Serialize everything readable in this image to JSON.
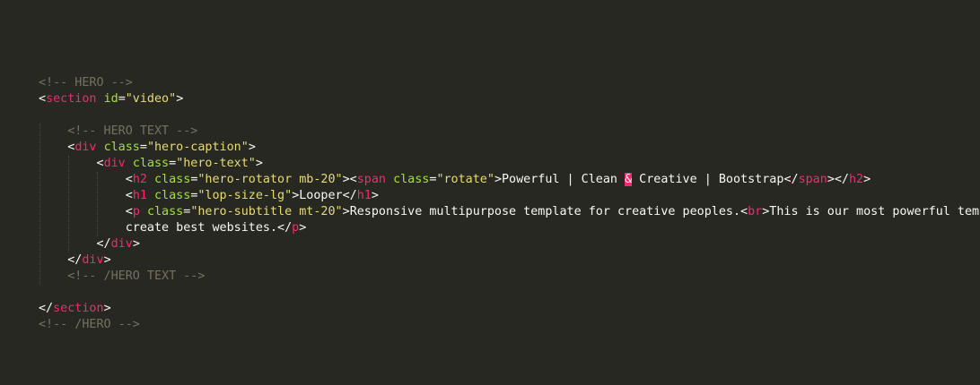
{
  "editor": {
    "theme": "dark",
    "colors": {
      "background": "#272822",
      "comment": "#75715e",
      "tag": "#f92672",
      "attribute": "#a6e22e",
      "string": "#e6db74",
      "text": "#f8f8f2"
    },
    "lines": [
      [],
      [],
      [],
      [],
      [
        {
          "t": "comment",
          "v": "<!-- HERO -->"
        }
      ],
      [
        {
          "t": "punc",
          "v": "<"
        },
        {
          "t": "tag",
          "v": "section"
        },
        {
          "t": "punc",
          "v": " "
        },
        {
          "t": "attr",
          "v": "id"
        },
        {
          "t": "punc",
          "v": "="
        },
        {
          "t": "str",
          "v": "\"video\""
        },
        {
          "t": "punc",
          "v": ">"
        }
      ],
      [],
      [
        {
          "t": "text",
          "v": "    "
        },
        {
          "t": "comment",
          "v": "<!-- HERO TEXT -->"
        }
      ],
      [
        {
          "t": "text",
          "v": "    "
        },
        {
          "t": "punc",
          "v": "<"
        },
        {
          "t": "tag",
          "v": "div"
        },
        {
          "t": "punc",
          "v": " "
        },
        {
          "t": "attr",
          "v": "class"
        },
        {
          "t": "punc",
          "v": "="
        },
        {
          "t": "str",
          "v": "\"hero-caption\""
        },
        {
          "t": "punc",
          "v": ">"
        }
      ],
      [
        {
          "t": "text",
          "v": "        "
        },
        {
          "t": "punc",
          "v": "<"
        },
        {
          "t": "tag",
          "v": "div"
        },
        {
          "t": "punc",
          "v": " "
        },
        {
          "t": "attr",
          "v": "class"
        },
        {
          "t": "punc",
          "v": "="
        },
        {
          "t": "str",
          "v": "\"hero-text\""
        },
        {
          "t": "punc",
          "v": ">"
        }
      ],
      [
        {
          "t": "text",
          "v": "            "
        },
        {
          "t": "punc",
          "v": "<"
        },
        {
          "t": "tag",
          "v": "h2"
        },
        {
          "t": "punc",
          "v": " "
        },
        {
          "t": "attr",
          "v": "class"
        },
        {
          "t": "punc",
          "v": "="
        },
        {
          "t": "str",
          "v": "\"hero-rotator mb-20\""
        },
        {
          "t": "punc",
          "v": "><"
        },
        {
          "t": "tag",
          "v": "span"
        },
        {
          "t": "punc",
          "v": " "
        },
        {
          "t": "attr",
          "v": "class"
        },
        {
          "t": "punc",
          "v": "="
        },
        {
          "t": "str",
          "v": "\"rotate\""
        },
        {
          "t": "punc",
          "v": ">"
        },
        {
          "t": "text",
          "v": "Powerful | Clean "
        },
        {
          "t": "entity",
          "v": "&"
        },
        {
          "t": "text",
          "v": " Creative | Bootstrap"
        },
        {
          "t": "punc",
          "v": "</"
        },
        {
          "t": "tag",
          "v": "span"
        },
        {
          "t": "punc",
          "v": "></"
        },
        {
          "t": "tag",
          "v": "h2"
        },
        {
          "t": "punc",
          "v": ">"
        }
      ],
      [
        {
          "t": "text",
          "v": "            "
        },
        {
          "t": "punc",
          "v": "<"
        },
        {
          "t": "tag",
          "v": "h1"
        },
        {
          "t": "punc",
          "v": " "
        },
        {
          "t": "attr",
          "v": "class"
        },
        {
          "t": "punc",
          "v": "="
        },
        {
          "t": "str",
          "v": "\"lop-size-lg\""
        },
        {
          "t": "punc",
          "v": ">"
        },
        {
          "t": "text",
          "v": "Looper"
        },
        {
          "t": "punc",
          "v": "</"
        },
        {
          "t": "tag",
          "v": "h1"
        },
        {
          "t": "punc",
          "v": ">"
        }
      ],
      [
        {
          "t": "text",
          "v": "            "
        },
        {
          "t": "punc",
          "v": "<"
        },
        {
          "t": "tag",
          "v": "p"
        },
        {
          "t": "punc",
          "v": " "
        },
        {
          "t": "attr",
          "v": "class"
        },
        {
          "t": "punc",
          "v": "="
        },
        {
          "t": "str",
          "v": "\"hero-subtitle mt-20\""
        },
        {
          "t": "punc",
          "v": ">"
        },
        {
          "t": "text",
          "v": "Responsive multipurpose template for creative peoples."
        },
        {
          "t": "punc",
          "v": "<"
        },
        {
          "t": "tag",
          "v": "br"
        },
        {
          "t": "punc",
          "v": ">"
        },
        {
          "t": "text",
          "v": "This is our most powerful temp"
        }
      ],
      [
        {
          "t": "text",
          "v": "            create best websites."
        },
        {
          "t": "punc",
          "v": "</"
        },
        {
          "t": "tag",
          "v": "p"
        },
        {
          "t": "punc",
          "v": ">"
        }
      ],
      [
        {
          "t": "text",
          "v": "        "
        },
        {
          "t": "punc",
          "v": "</"
        },
        {
          "t": "tag",
          "v": "div"
        },
        {
          "t": "punc",
          "v": ">"
        }
      ],
      [
        {
          "t": "text",
          "v": "    "
        },
        {
          "t": "punc",
          "v": "</"
        },
        {
          "t": "tag",
          "v": "div"
        },
        {
          "t": "punc",
          "v": ">"
        }
      ],
      [
        {
          "t": "text",
          "v": "    "
        },
        {
          "t": "comment",
          "v": "<!-- /HERO TEXT -->"
        }
      ],
      [],
      [
        {
          "t": "punc",
          "v": "</"
        },
        {
          "t": "tag",
          "v": "section"
        },
        {
          "t": "punc",
          "v": ">"
        }
      ],
      [
        {
          "t": "comment",
          "v": "<!-- /HERO -->"
        }
      ]
    ]
  }
}
